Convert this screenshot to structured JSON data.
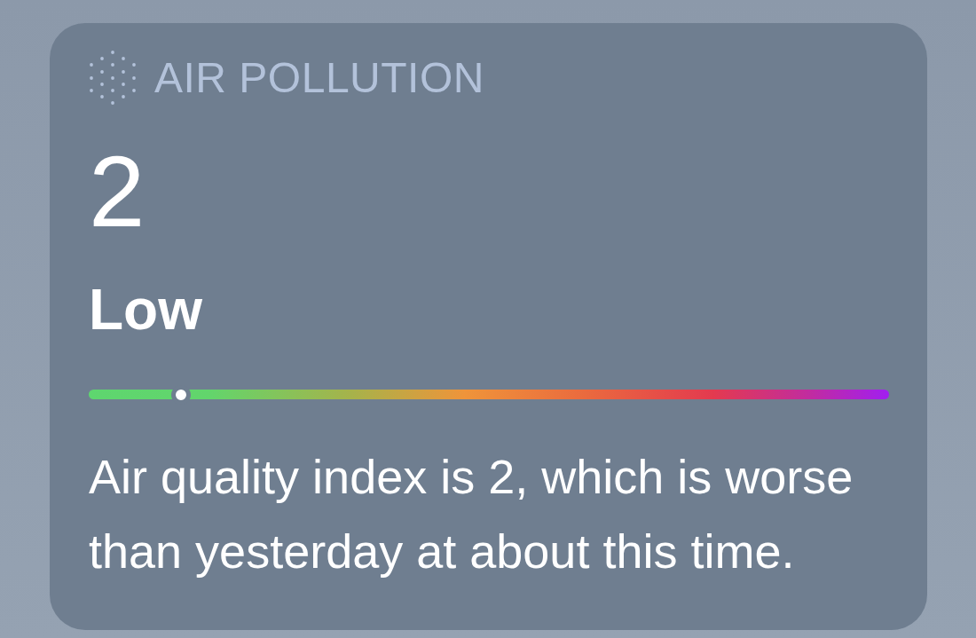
{
  "widget": {
    "title": "AIR POLLUTION",
    "value": "2",
    "category": "Low",
    "scale": {
      "level": 0.115
    },
    "description": "Air quality index is 2, which is worse than yesterday at about this time."
  }
}
